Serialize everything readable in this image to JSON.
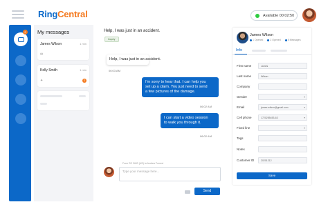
{
  "header": {
    "logo_ring": "Ring",
    "logo_central": "Central",
    "status": "Available  00:02:50",
    "status_color": "#2ecc40"
  },
  "rail": {
    "active_icon": "messages-icon",
    "badge": "2"
  },
  "messages_list": {
    "title": "My messages",
    "items": [
      {
        "name": "James Wilson",
        "time": "1 min",
        "icon": "chat-icon"
      },
      {
        "name": "Kelly Smith",
        "time": "1 min",
        "icon": "twitter-icon",
        "badge": "2"
      }
    ]
  },
  "conversation": {
    "title": "Help, I was just in an accident.",
    "tag": "Inquiry",
    "messages": [
      {
        "from": "customer",
        "text": "Help, I was just in an accident.",
        "time": "06:03 AM"
      },
      {
        "from": "agent",
        "lines": [
          "I'm sorry to hear that. I can help you",
          "set up a claim. You just need to send",
          "a few pictures of the damage."
        ],
        "time": "06:02 AM"
      },
      {
        "from": "agent",
        "lines": [
          "I can start a video session",
          "to walk you through it."
        ],
        "time": "06:02 AM"
      }
    ],
    "compose_meta": "From RC SMS (US) to Andrea Forrest",
    "compose_placeholder": "Type your message here...",
    "send_label": "Send"
  },
  "contact": {
    "name": "James Wilson",
    "stats": [
      "1 Opened",
      "2 Opened",
      "5 Messages"
    ],
    "tab_info": "Info",
    "fields": [
      {
        "label": "First name",
        "value": "James"
      },
      {
        "label": "Last name",
        "value": "Wilson"
      },
      {
        "label": "Company",
        "value": ""
      },
      {
        "label": "Gender",
        "value": "",
        "dropdown": true
      },
      {
        "label": "Email",
        "value": "james.wilson@gmail.com",
        "dropdown": true
      },
      {
        "label": "Cell phone",
        "value": "1720255453-63",
        "dropdown": true
      },
      {
        "label": "Fixed line",
        "value": "",
        "dropdown": true
      },
      {
        "label": "Tags",
        "value": ""
      },
      {
        "label": "Notes",
        "value": ""
      },
      {
        "label": "Customer ID",
        "value": "20201212"
      }
    ],
    "save_label": "Save"
  },
  "colors": {
    "brand_blue": "#0c68c8",
    "brand_orange": "#f47a20"
  }
}
